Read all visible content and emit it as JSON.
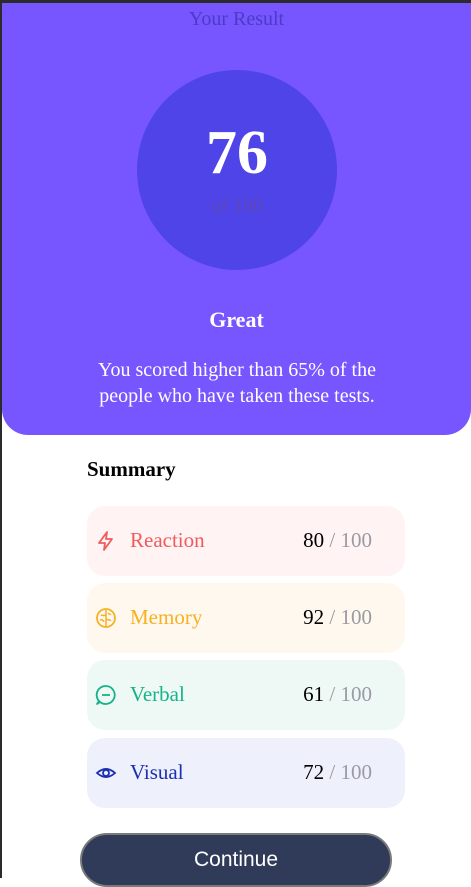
{
  "hero": {
    "title": "Your Result",
    "score": "76",
    "score_max": "of 100",
    "rating": "Great",
    "description": "You scored higher than 65% of the people who have taken these tests."
  },
  "summary": {
    "title": "Summary",
    "items": [
      {
        "label": "Reaction",
        "score": "80",
        "separator": "/",
        "total": "100",
        "color": "#ef5b5b",
        "bg": "#fff3f3",
        "icon": "lightning-icon"
      },
      {
        "label": "Memory",
        "score": "92",
        "separator": "/",
        "total": "100",
        "color": "#f8b024",
        "bg": "#fff8ee",
        "icon": "brain-icon"
      },
      {
        "label": "Verbal",
        "score": "61",
        "separator": "/",
        "total": "100",
        "color": "#16b38a",
        "bg": "#eef9f5",
        "icon": "chat-icon"
      },
      {
        "label": "Visual",
        "score": "72",
        "separator": "/",
        "total": "100",
        "color": "#1c2fb2",
        "bg": "#eef0fb",
        "icon": "eye-icon"
      }
    ]
  },
  "continue_label": "Continue",
  "colors": {
    "hero_bg": "#7755ff",
    "circle_bg": "#4f44e8",
    "button_bg": "#303b5a"
  }
}
